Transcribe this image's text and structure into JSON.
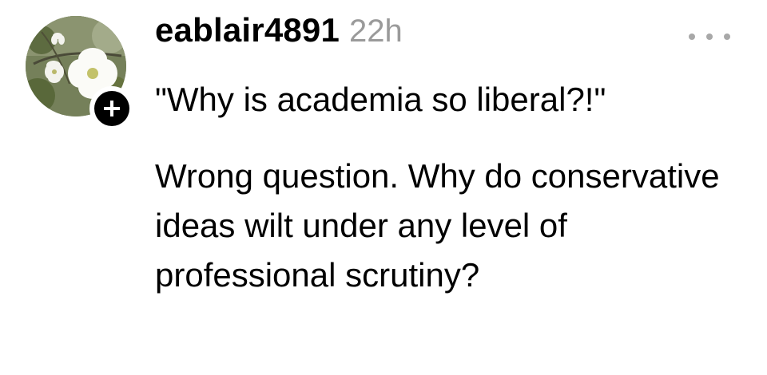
{
  "post": {
    "username": "eablair4891",
    "timestamp": "22h",
    "more_icon": "ellipsis-icon",
    "follow_icon": "plus-icon",
    "paragraphs": [
      "\"Why is academia so liberal?!\"",
      "Wrong question. Why do conservative ideas wilt under any level of professional scrutiny?"
    ]
  },
  "colors": {
    "text": "#000000",
    "timestamp": "#9a9a9a",
    "more_dots": "#a8a8a8",
    "background": "#ffffff"
  }
}
